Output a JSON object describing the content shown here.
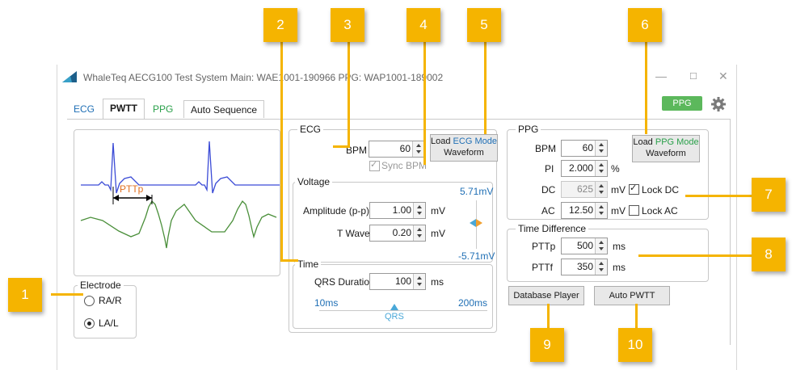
{
  "window": {
    "title": "WhaleTeq AECG100 Test System   Main: WAE1001-190966  PPG: WAP1001-189002",
    "minimize": "—",
    "maximize": "☐",
    "close": "✕"
  },
  "tabs": [
    {
      "label": "ECG",
      "color": "#1f6fb5"
    },
    {
      "label": "PWTT",
      "active": true
    },
    {
      "label": "PPG",
      "color": "#2aa04a"
    },
    {
      "label": "Auto Sequence"
    }
  ],
  "ppg_badge": "PPG",
  "colors": {
    "accent": "#f5b400",
    "ecg_wave": "#3b4bd6",
    "ppg_wave": "#4a8f3a",
    "pttp": "#e07020",
    "badge": "#5cb85c"
  },
  "waveform": {
    "pttp_label": "PTTp"
  },
  "electrode": {
    "title": "Electrode",
    "options": [
      {
        "label": "RA/R",
        "selected": false
      },
      {
        "label": "LA/L",
        "selected": true
      }
    ]
  },
  "ecg": {
    "title": "ECG",
    "bpm_label": "BPM",
    "bpm_value": "60",
    "sync_bpm": "Sync BPM",
    "load_button": {
      "line1_prefix": "Load ",
      "line1_highlight": "ECG Mode",
      "line2": "Waveform"
    },
    "voltage": {
      "title": "Voltage",
      "amplitude_label": "Amplitude (p-p)",
      "amplitude_value": "1.00",
      "amplitude_unit": "mV",
      "twave_label": "T Wave",
      "twave_value": "0.20",
      "twave_unit": "mV",
      "max_label": "5.71mV",
      "min_label": "-5.71mV"
    },
    "time": {
      "title": "Time",
      "qrs_label": "QRS Duration",
      "qrs_value": "100",
      "qrs_unit": "ms",
      "min_label": "10ms",
      "max_label": "200ms",
      "slider_label": "QRS"
    }
  },
  "ppg": {
    "title": "PPG",
    "bpm_label": "BPM",
    "bpm_value": "60",
    "pi_label": "PI",
    "pi_value": "2.000",
    "pi_unit": "%",
    "dc_label": "DC",
    "dc_value": "625",
    "dc_unit": "mV",
    "lock_dc": "Lock DC",
    "ac_label": "AC",
    "ac_value": "12.50",
    "ac_unit": "mV",
    "lock_ac": "Lock AC",
    "load_button": {
      "line1_prefix": "Load ",
      "line1_highlight": "PPG Mode",
      "line2": "Waveform"
    }
  },
  "time_difference": {
    "title": "Time Difference",
    "pttp_label": "PTTp",
    "pttp_value": "500",
    "pttp_unit": "ms",
    "pttf_label": "PTTf",
    "pttf_value": "350",
    "pttf_unit": "ms"
  },
  "buttons": {
    "database_player": "Database Player",
    "auto_pwtt": "Auto PWTT"
  },
  "callouts": [
    "1",
    "2",
    "3",
    "4",
    "5",
    "6",
    "7",
    "8",
    "9",
    "10"
  ]
}
